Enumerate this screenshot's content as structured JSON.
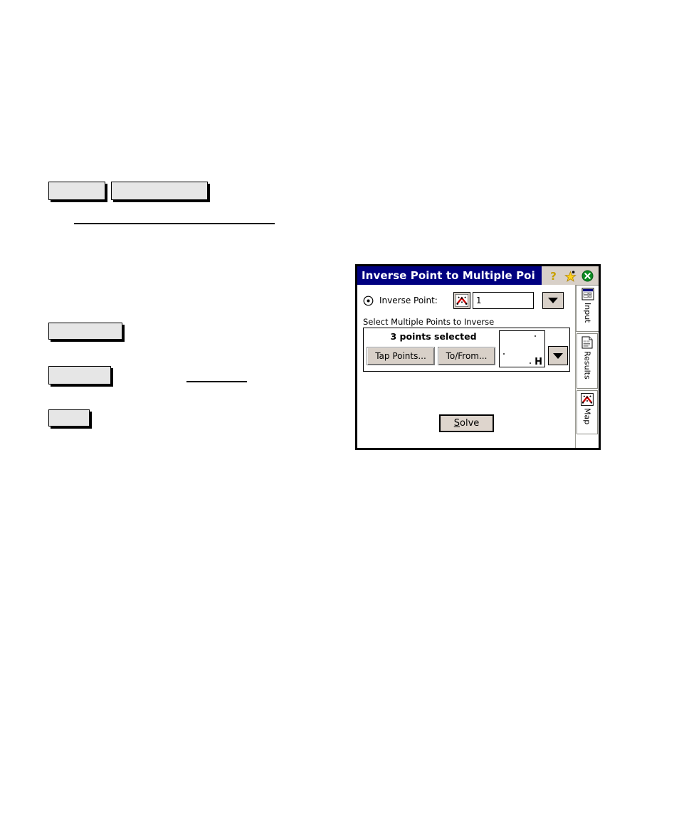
{
  "document": {
    "redacted_blocks": [
      "",
      "",
      "",
      "",
      ""
    ],
    "rules": [
      "",
      ""
    ]
  },
  "dialog": {
    "title": "Inverse Point to Multiple Poi",
    "titlebar_buttons": [
      {
        "name": "help-icon",
        "label": "?"
      },
      {
        "name": "favorite-star-icon",
        "label": ""
      },
      {
        "name": "close-icon",
        "label": ""
      }
    ],
    "colors": {
      "titlebar": "#000080",
      "titlebar_text": "#ffffff",
      "button_face": "#d8d0c8",
      "close_button": "#008000",
      "client": "#ffffff",
      "map_icon_accent": "#cc0000"
    },
    "inverse_point": {
      "radio_name": "inverse-point-radio",
      "label": "Inverse Point:",
      "map_button_icon": "map-pick-icon",
      "value": "1",
      "placeholder": "",
      "dropdown_icon": "chevron-down-icon"
    },
    "group": {
      "label": "Select Multiple Points to Inverse",
      "status": "3 points selected",
      "tap_points_label": "Tap Points...",
      "to_from_label": "To/From...",
      "preview_text": "H",
      "dropdown_icon": "chevron-down-icon"
    },
    "solve": {
      "accel": "S",
      "rest": "olve"
    },
    "tabs": [
      {
        "label": "Input",
        "icon": "form-window-icon",
        "selected": true
      },
      {
        "label": "Results",
        "icon": "document-report-icon",
        "selected": false
      },
      {
        "label": "Map",
        "icon": "map-pick-icon",
        "selected": false
      }
    ]
  }
}
